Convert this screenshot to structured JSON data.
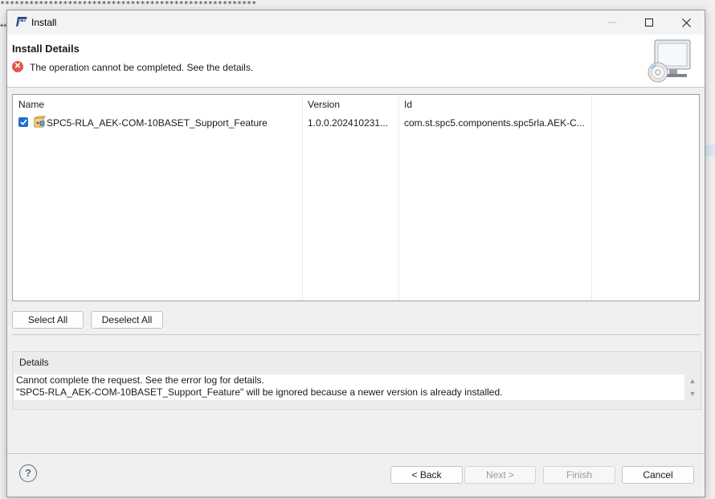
{
  "window": {
    "title": "Install",
    "minimize_icon": "minimize-icon",
    "maximize_icon": "maximize-icon",
    "close_icon": "close-icon"
  },
  "header": {
    "title": "Install Details",
    "message": "The operation cannot be completed.  See the details.",
    "status_icon": "error-icon",
    "banner_icon": "install-wizard-icon"
  },
  "table": {
    "columns": [
      "Name",
      "Version",
      "Id"
    ],
    "rows": [
      {
        "checked": true,
        "name": "SPC5-RLA_AEK-COM-10BASET_Support_Feature",
        "version": "1.0.0.202410231...",
        "id": "com.st.spc5.components.spc5rla.AEK-C..."
      }
    ]
  },
  "selection_buttons": {
    "select_all": "Select All",
    "deselect_all": "Deselect All"
  },
  "details": {
    "label": "Details",
    "lines": [
      "Cannot complete the request.  See the error log for details.",
      "\"SPC5-RLA_AEK-COM-10BASET_Support_Feature\" will be ignored because a newer version is already installed."
    ]
  },
  "footer": {
    "help_icon": "help-icon",
    "back": "< Back",
    "next": "Next >",
    "finish": "Finish",
    "cancel": "Cancel"
  },
  "colors": {
    "accent": "#1f6fd1",
    "error": "#e05a4c",
    "dialog_bg": "#f0f0f0"
  }
}
